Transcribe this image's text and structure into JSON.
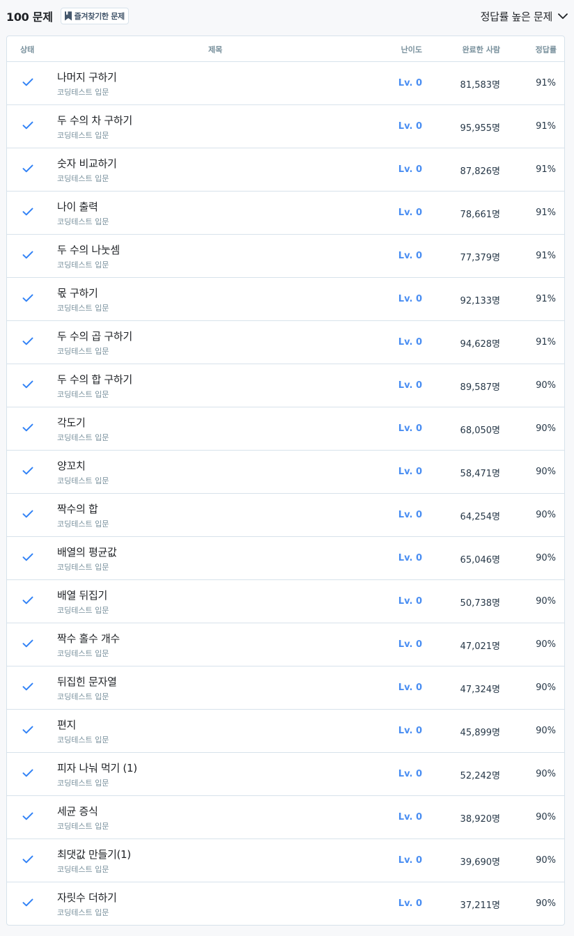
{
  "header": {
    "count_label": "100 문제",
    "bookmark_label": "즐겨찾기한 문제",
    "sort_label": "정답률 높은 문제"
  },
  "table": {
    "columns": {
      "status": "상태",
      "title": "제목",
      "level": "난이도",
      "completed": "완료한 사람",
      "rate": "정답률"
    }
  },
  "colors": {
    "check": "#3182f6",
    "level": "#4a8ef2",
    "border": "#d7e2eb",
    "muted": "#78909c"
  },
  "rows": [
    {
      "title": "나머지 구하기",
      "category": "코딩테스트 입문",
      "level": "Lv. 0",
      "completed": "81,583명",
      "rate": "91%",
      "status": "solved"
    },
    {
      "title": "두 수의 차 구하기",
      "category": "코딩테스트 입문",
      "level": "Lv. 0",
      "completed": "95,955명",
      "rate": "91%",
      "status": "solved"
    },
    {
      "title": "숫자 비교하기",
      "category": "코딩테스트 입문",
      "level": "Lv. 0",
      "completed": "87,826명",
      "rate": "91%",
      "status": "solved"
    },
    {
      "title": "나이 출력",
      "category": "코딩테스트 입문",
      "level": "Lv. 0",
      "completed": "78,661명",
      "rate": "91%",
      "status": "solved"
    },
    {
      "title": "두 수의 나눗셈",
      "category": "코딩테스트 입문",
      "level": "Lv. 0",
      "completed": "77,379명",
      "rate": "91%",
      "status": "solved"
    },
    {
      "title": "몫 구하기",
      "category": "코딩테스트 입문",
      "level": "Lv. 0",
      "completed": "92,133명",
      "rate": "91%",
      "status": "solved"
    },
    {
      "title": "두 수의 곱 구하기",
      "category": "코딩테스트 입문",
      "level": "Lv. 0",
      "completed": "94,628명",
      "rate": "91%",
      "status": "solved"
    },
    {
      "title": "두 수의 합 구하기",
      "category": "코딩테스트 입문",
      "level": "Lv. 0",
      "completed": "89,587명",
      "rate": "90%",
      "status": "solved"
    },
    {
      "title": "각도기",
      "category": "코딩테스트 입문",
      "level": "Lv. 0",
      "completed": "68,050명",
      "rate": "90%",
      "status": "solved"
    },
    {
      "title": "양꼬치",
      "category": "코딩테스트 입문",
      "level": "Lv. 0",
      "completed": "58,471명",
      "rate": "90%",
      "status": "solved"
    },
    {
      "title": "짝수의 합",
      "category": "코딩테스트 입문",
      "level": "Lv. 0",
      "completed": "64,254명",
      "rate": "90%",
      "status": "solved"
    },
    {
      "title": "배열의 평균값",
      "category": "코딩테스트 입문",
      "level": "Lv. 0",
      "completed": "65,046명",
      "rate": "90%",
      "status": "solved"
    },
    {
      "title": "배열 뒤집기",
      "category": "코딩테스트 입문",
      "level": "Lv. 0",
      "completed": "50,738명",
      "rate": "90%",
      "status": "solved"
    },
    {
      "title": "짝수 홀수 개수",
      "category": "코딩테스트 입문",
      "level": "Lv. 0",
      "completed": "47,021명",
      "rate": "90%",
      "status": "solved"
    },
    {
      "title": "뒤집힌 문자열",
      "category": "코딩테스트 입문",
      "level": "Lv. 0",
      "completed": "47,324명",
      "rate": "90%",
      "status": "solved"
    },
    {
      "title": "편지",
      "category": "코딩테스트 입문",
      "level": "Lv. 0",
      "completed": "45,899명",
      "rate": "90%",
      "status": "solved"
    },
    {
      "title": "피자 나눠 먹기 (1)",
      "category": "코딩테스트 입문",
      "level": "Lv. 0",
      "completed": "52,242명",
      "rate": "90%",
      "status": "solved"
    },
    {
      "title": "세균 증식",
      "category": "코딩테스트 입문",
      "level": "Lv. 0",
      "completed": "38,920명",
      "rate": "90%",
      "status": "solved"
    },
    {
      "title": "최댓값 만들기(1)",
      "category": "코딩테스트 입문",
      "level": "Lv. 0",
      "completed": "39,690명",
      "rate": "90%",
      "status": "solved"
    },
    {
      "title": "자릿수 더하기",
      "category": "코딩테스트 입문",
      "level": "Lv. 0",
      "completed": "37,211명",
      "rate": "90%",
      "status": "solved"
    }
  ]
}
